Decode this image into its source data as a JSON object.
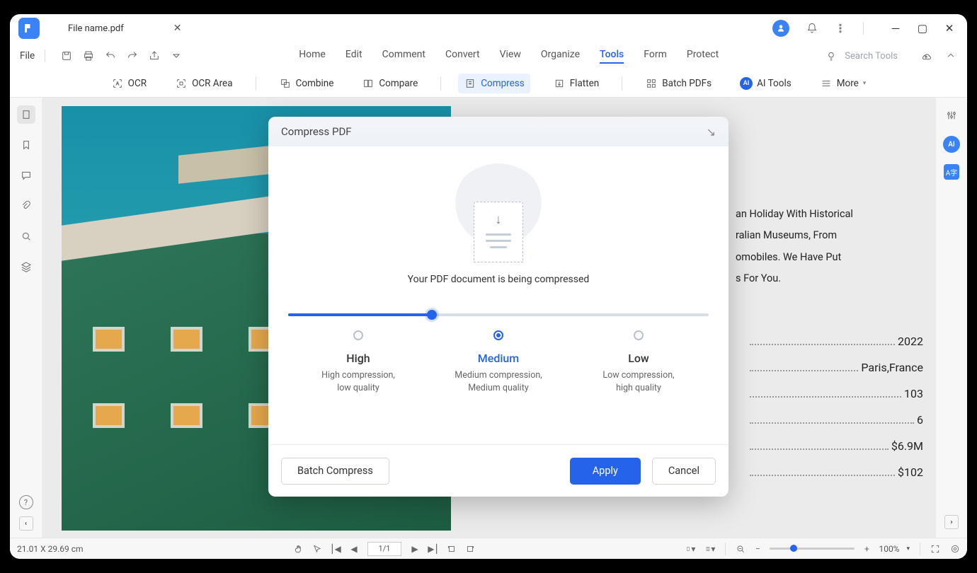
{
  "titlebar": {
    "tab_name": "File name.pdf"
  },
  "menubar": {
    "file": "File",
    "tabs": [
      "Home",
      "Edit",
      "Comment",
      "Convert",
      "View",
      "Organize",
      "Tools",
      "Form",
      "Protect"
    ],
    "active_tab": "Tools",
    "search_placeholder": "Search Tools"
  },
  "toolbar": {
    "ocr": "OCR",
    "ocr_area": "OCR Area",
    "combine": "Combine",
    "compare": "Compare",
    "compress": "Compress",
    "flatten": "Flatten",
    "batch": "Batch PDFs",
    "ai": "AI Tools",
    "more": "More"
  },
  "document": {
    "paragraph_lines": [
      "an Holiday With Historical",
      "ralian Museums, From",
      "omobiles. We Have Put",
      "s For You."
    ],
    "data": [
      {
        "value": "2022"
      },
      {
        "value": "Paris,France"
      },
      {
        "value": "103"
      },
      {
        "value": "6"
      },
      {
        "value": "$6.9M"
      },
      {
        "value": "$102"
      }
    ]
  },
  "dialog": {
    "title": "Compress PDF",
    "message": "Your PDF document is being compressed",
    "options": {
      "high": {
        "title": "High",
        "desc1": "High compression,",
        "desc2": "low quality"
      },
      "medium": {
        "title": "Medium",
        "desc1": "Medium compression,",
        "desc2": "Medium quality"
      },
      "low": {
        "title": "Low",
        "desc1": "Low compression,",
        "desc2": "high quality"
      }
    },
    "batch_compress": "Batch Compress",
    "apply": "Apply",
    "cancel": "Cancel"
  },
  "statusbar": {
    "dims": "21.01 X 29.69 cm",
    "page": "1/1",
    "zoom": "100%"
  }
}
